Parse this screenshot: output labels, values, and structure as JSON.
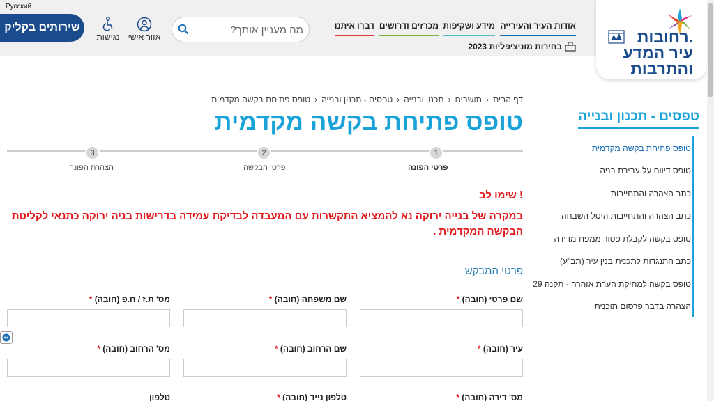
{
  "header": {
    "language": "Русский",
    "services_button": "שירותים בקליק",
    "accessibility": "נגישות",
    "personal_area": "אזור אישי",
    "search_placeholder": "מה מעניין אותך?",
    "nav": {
      "about": "אודות העיר והעירייה",
      "info": "מידע ושקיפות",
      "tenders": "מכרזים ודרושים",
      "contact": "דברו איתנו",
      "elections": "בחירות מוניציפליות 2023"
    },
    "logo": {
      "line1": "רחובות.",
      "line2": "עיר המדע",
      "line3": "והתרבות"
    }
  },
  "breadcrumb": [
    "דף הבית",
    "תושבים",
    "תכנון ובנייה",
    "טפסים - תכנון ובנייה",
    "טופס פתיחת בקשה מקדמית"
  ],
  "page_title": "טופס פתיחת בקשה מקדמית",
  "steps": [
    {
      "number": "1",
      "label": "פרטי הפונה"
    },
    {
      "number": "2",
      "label": "פרטי הבקשה"
    },
    {
      "number": "3",
      "label": "הצהרת הפונה"
    }
  ],
  "notice": {
    "title": "שימו לב !",
    "text": "במקרה של בנייה ירוקה נא להמציא התקשרות עם המעבדה לבדיקת עמידה בדרישות בניה ירוקה כתנאי לקליטת הבקשה המקדמית ."
  },
  "section_title": "פרטי המבקש",
  "form": {
    "first_name": "שם פרטי (חובה)",
    "last_name": "שם משפחה (חובה)",
    "id_number": "מס' ת.ז / ח.פ (חובה)",
    "city": "עיר (חובה)",
    "street": "שם הרחוב (חובה)",
    "house_number": "מס' הרחוב (חובה)",
    "apartment": "מס' דירה (חובה)",
    "mobile": "טלפון נייד (חובה)",
    "phone": "טלפון",
    "required_mark": "*"
  },
  "sidebar": {
    "title": "טפסים - תכנון ובנייה",
    "items": [
      "טופס פתיחת בקשה מקדמית",
      "טופס דיווח על עבירת בניה",
      "כתב הצהרה והתחייבות",
      "כתב הצהרה והתחייבות היטל השבחה",
      "טופס בקשה לקבלת פטור ממפת מדידה",
      "כתב התנגדות לתכנית בנין עיר (תב\"ע)",
      "טופס בקשה למחיקת הערת אזהרה - תקנה 29",
      "הצהרה בדבר פרסום תוכנית"
    ]
  },
  "colors": {
    "brand_blue": "#1a4b8c",
    "title_cyan": "#1aa3d9",
    "warning_red": "#e0191b"
  }
}
